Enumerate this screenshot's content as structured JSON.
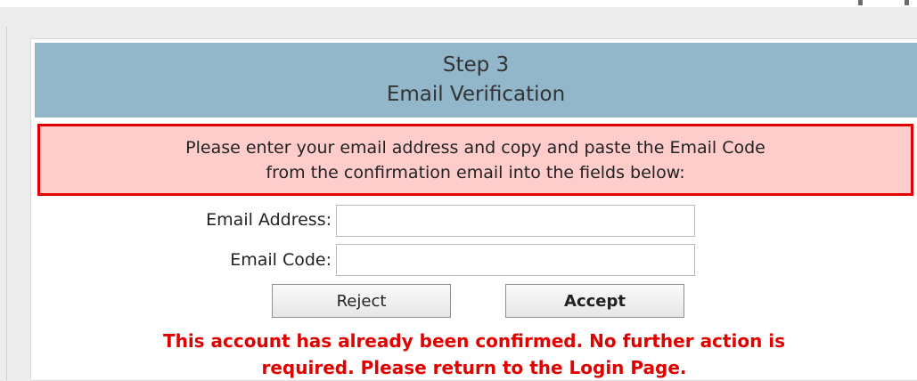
{
  "header": {
    "step": "Step 3",
    "title": "Email Verification"
  },
  "alert": {
    "line1": "Please enter your email address and copy and paste the Email Code",
    "line2": "from the confirmation email into the fields below:"
  },
  "form": {
    "email_address_label": "Email Address:",
    "email_address_value": "",
    "email_code_label": "Email Code:",
    "email_code_value": ""
  },
  "buttons": {
    "reject_label": "Reject",
    "accept_label": "Accept"
  },
  "error": {
    "line1": "This account has already been confirmed. No further action is",
    "line2": "required. Please return to the Login Page."
  },
  "colors": {
    "header_bg": "#92b7cb",
    "alert_bg": "#ffcccc",
    "alert_border": "#e00000",
    "error_text": "#e00000"
  }
}
